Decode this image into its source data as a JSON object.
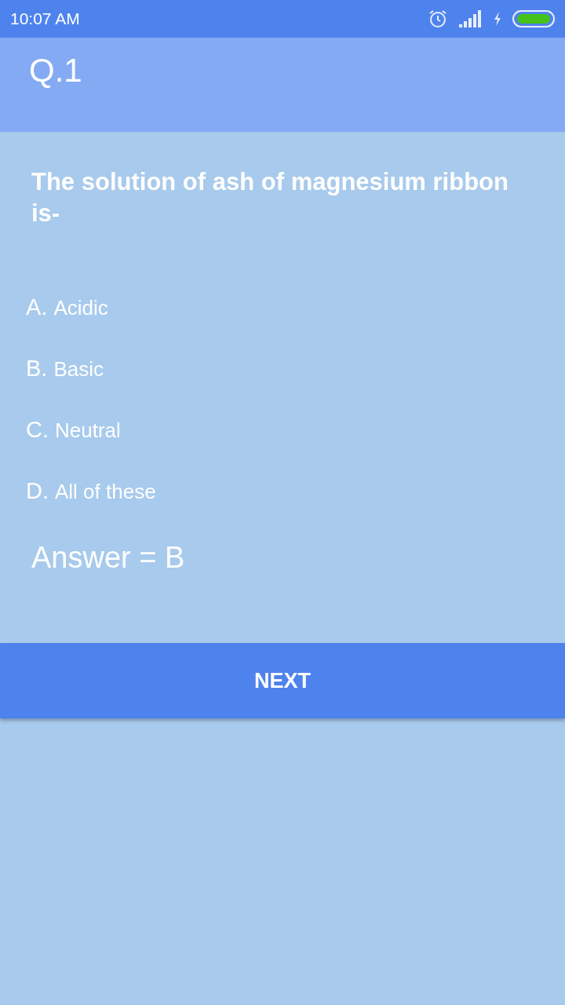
{
  "status_bar": {
    "time": "10:07 AM"
  },
  "header": {
    "title": "Q.1"
  },
  "question": "The solution of ash of magnesium ribbon is-",
  "options": [
    {
      "letter": "A.",
      "text": "Acidic"
    },
    {
      "letter": "B.",
      "text": "Basic"
    },
    {
      "letter": "C.",
      "text": "Neutral"
    },
    {
      "letter": "D.",
      "text": "All of these"
    }
  ],
  "answer": "Answer = B",
  "next_button": "NEXT"
}
